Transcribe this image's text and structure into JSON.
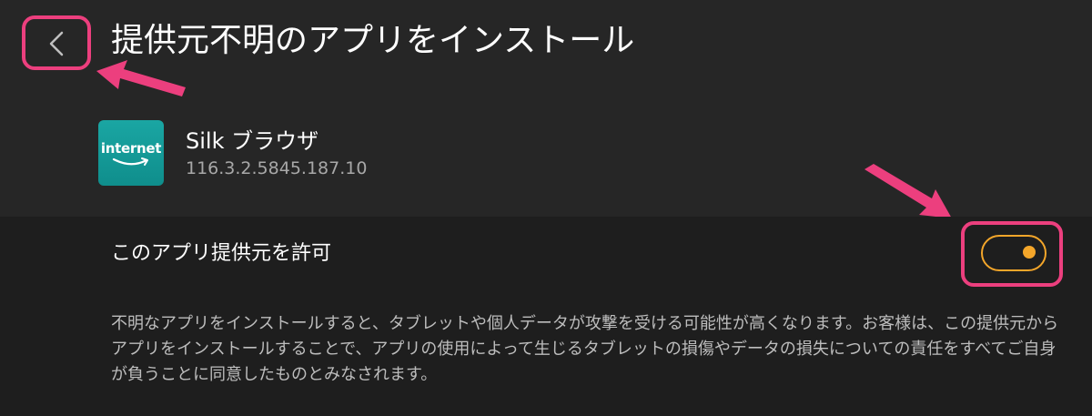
{
  "header": {
    "title": "提供元不明のアプリをインストール"
  },
  "app": {
    "icon_text": "internet",
    "name": "Silk ブラウザ",
    "version": "116.3.2.5845.187.10"
  },
  "setting": {
    "label": "このアプリ提供元を許可",
    "enabled": true
  },
  "warning": {
    "text": "不明なアプリをインストールすると、タブレットや個人データが攻撃を受ける可能性が高くなります。お客様は、この提供元からアプリをインストールすることで、アプリの使用によって生じるタブレットの損傷やデータの損失についての責任をすべてご自身が負うことに同意したものとみなされます。"
  },
  "colors": {
    "background": "#262626",
    "panel": "#1e1e1e",
    "accent_toggle": "#f4a62a",
    "annotation": "#ec3f7e"
  },
  "icons": [
    "chevron-left-icon",
    "amazon-smile-icon",
    "annotation-arrow"
  ]
}
